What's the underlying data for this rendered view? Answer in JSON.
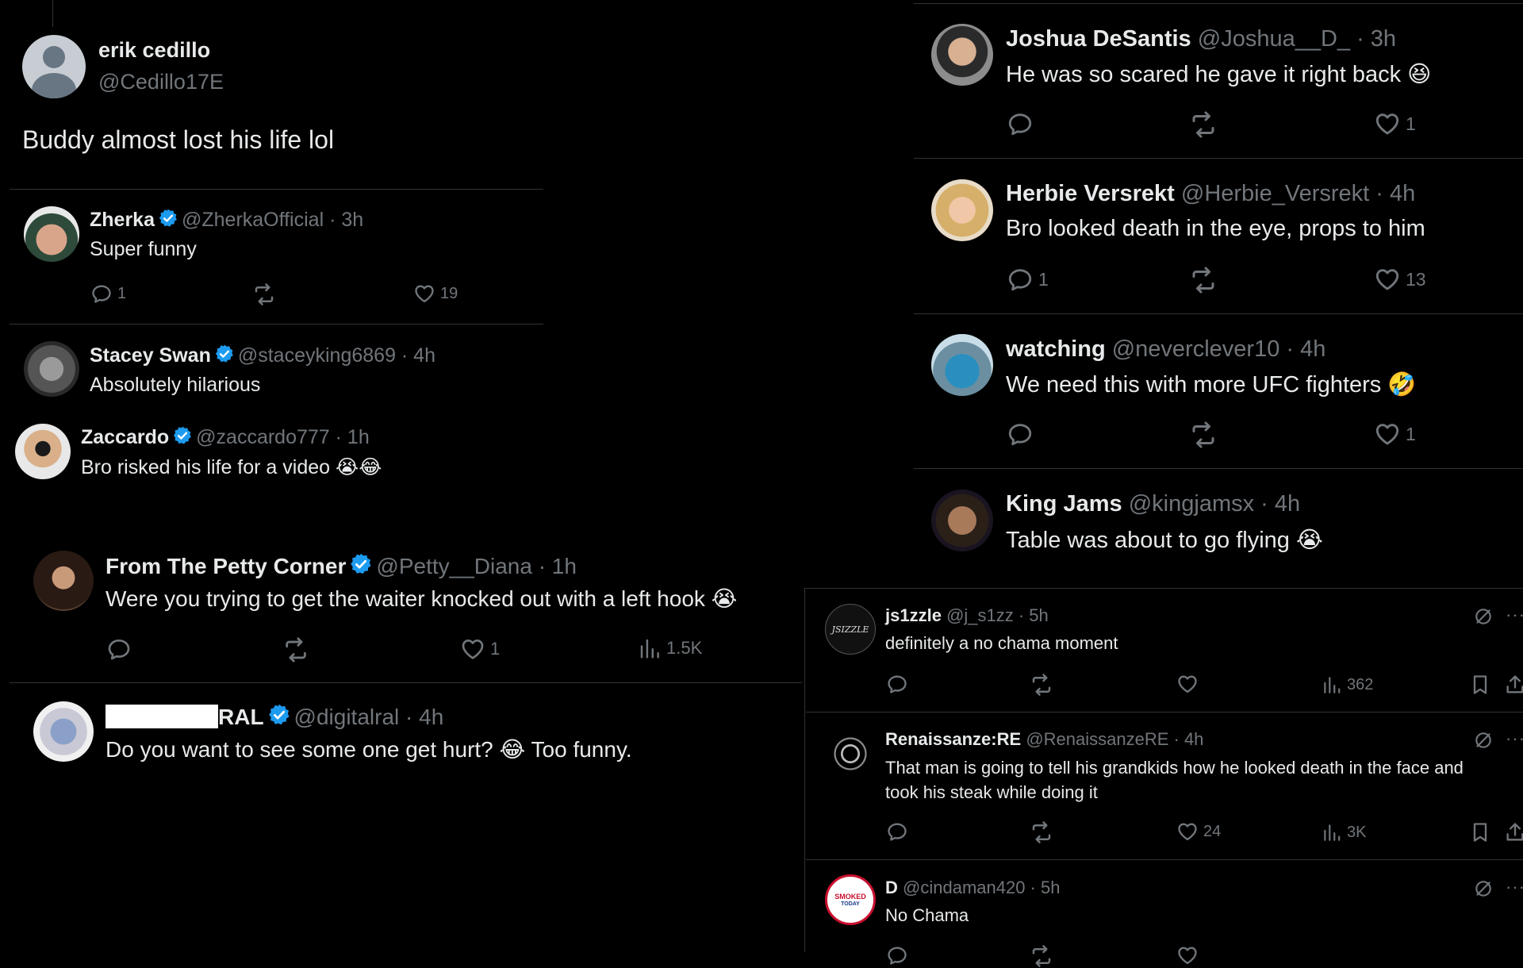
{
  "main_post": {
    "name": "erik cedillo",
    "handle": "@Cedillo17E",
    "text": "Buddy almost lost his life lol"
  },
  "left_replies": [
    {
      "name": "Zherka",
      "meta": "@ZherkaOfficial · 3h",
      "text": "Super funny",
      "replies": "1",
      "likes": "19"
    },
    {
      "name": "Stacey Swan",
      "meta": "@staceyking6869 · 4h",
      "text": "Absolutely hilarious"
    },
    {
      "name": "Zaccardo",
      "meta": "@zaccardo777 · 1h",
      "text": "Bro risked his life for a video"
    },
    {
      "name": "From The Petty Corner",
      "meta": "@Petty__Diana · 1h",
      "text": "Were you trying to get the waiter knocked out with a left hook",
      "likes": "1",
      "views": "1.5K"
    },
    {
      "name_suffix": "RAL",
      "meta": "@digitalral · 4h",
      "text_before": "Do you want to see some one get hurt?",
      "text_after": "Too funny."
    }
  ],
  "right_replies": [
    {
      "name": "Joshua DeSantis",
      "meta": "@Joshua__D_ · 3h",
      "text": "He was so scared he gave it right back",
      "likes": "1"
    },
    {
      "name": "Herbie Versrekt",
      "meta": "@Herbie_Versrekt · 4h",
      "text": "Bro looked death in the eye, props to him",
      "replies": "1",
      "likes": "13"
    },
    {
      "name": "watching",
      "meta": "@neverclever10 · 4h",
      "text": "We need this with more UFC fighters",
      "likes": "1"
    },
    {
      "name": "King Jams",
      "meta": "@kingjamsx · 4h",
      "text": "Table was about to go flying"
    }
  ],
  "bottom_replies": [
    {
      "name": "js1zzle",
      "meta": "@j_s1zz · 5h",
      "text": "definitely a no chama moment",
      "views": "362",
      "avatar_text": "JSIZZLE"
    },
    {
      "name": "Renaissanze:RE",
      "meta": "@RenaissanzeRE · 4h",
      "text_line1": "That man is going to tell his grandkids how he looked death in the face and",
      "text_line2": "took his steak while doing it",
      "likes": "24",
      "views": "3K"
    },
    {
      "name": "D",
      "meta": "@cindaman420 · 5h",
      "text": "No Chama",
      "avatar_line1": "SMOKED",
      "avatar_line2": "TODAY"
    }
  ],
  "colors": {
    "background": "#000000",
    "text": "#e7e9ea",
    "muted": "#71767b",
    "verified": "#1d9bf0",
    "divider": "#2f3336"
  },
  "icons": [
    "reply-icon",
    "repost-icon",
    "like-icon",
    "views-icon",
    "bookmark-icon",
    "share-icon",
    "grok-icon",
    "more-icon",
    "verified-badge-icon"
  ]
}
